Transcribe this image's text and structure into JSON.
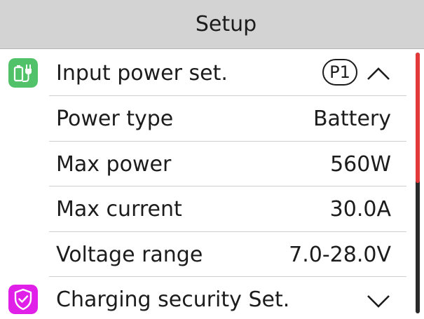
{
  "header": {
    "title": "Setup"
  },
  "colors": {
    "input_icon_bg": "#52c26a",
    "security_icon_bg": "#e020e8",
    "scroll_thumb": "#e23a3a"
  },
  "sections": [
    {
      "label": "Input power set.",
      "icon": "battery-plug-icon",
      "badge": "P1",
      "expanded": true,
      "items": [
        {
          "label": "Power type",
          "value": "Battery"
        },
        {
          "label": "Max power",
          "value": "560W"
        },
        {
          "label": "Max current",
          "value": "30.0A"
        },
        {
          "label": "Voltage range",
          "value": "7.0-28.0V"
        }
      ]
    },
    {
      "label": "Charging security Set.",
      "icon": "shield-check-icon",
      "expanded": false
    }
  ],
  "scroll": {
    "position_fraction": 0.0,
    "visible_fraction": 0.5
  }
}
